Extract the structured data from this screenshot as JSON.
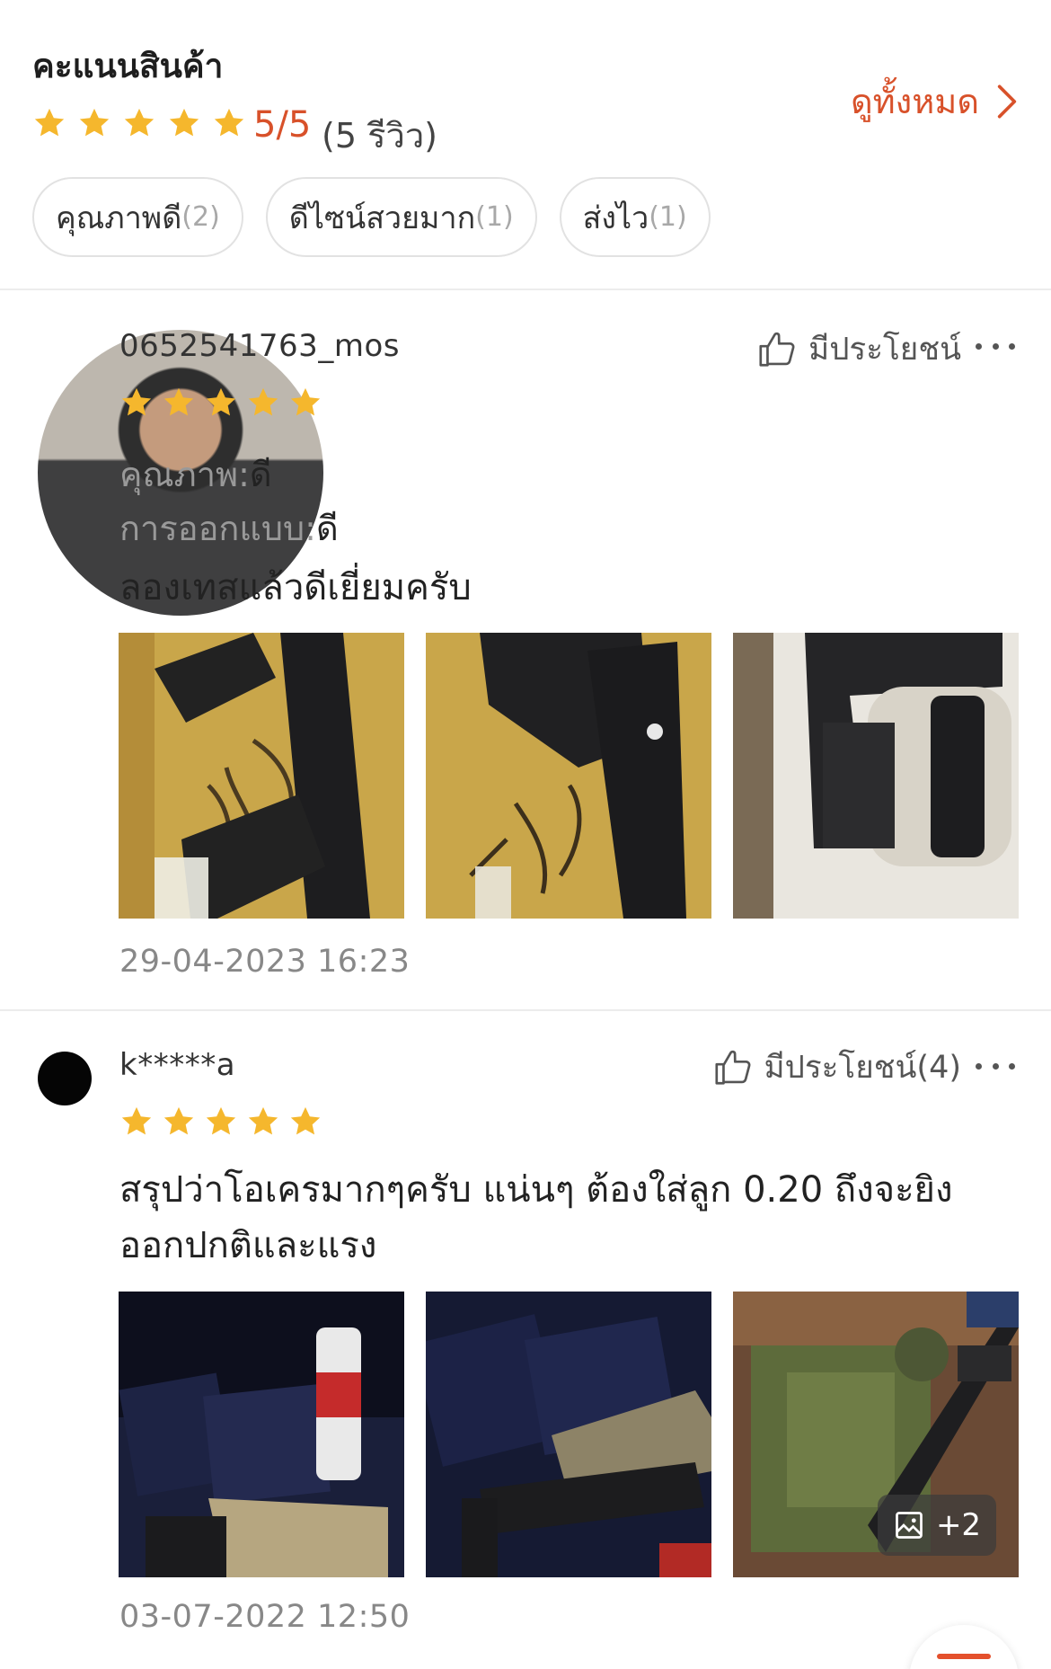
{
  "summary": {
    "title": "คะแนนสินค้า",
    "score": "5/5",
    "review_count": "(5 รีวิว)",
    "see_all": "ดูทั้งหมด",
    "tags": [
      {
        "label": "คุณภาพดี",
        "count": "(2)"
      },
      {
        "label": "ดีไซน์สวยมาก",
        "count": "(1)"
      },
      {
        "label": "ส่งไว",
        "count": "(1)"
      }
    ]
  },
  "reviews": [
    {
      "username": "0652541763_mos",
      "helpful": "มีประโยชน์",
      "rating": 5,
      "attributes": [
        {
          "label": "คุณภาพ:",
          "value": "ดี"
        },
        {
          "label": "การออกแบบ:",
          "value": "ดี"
        }
      ],
      "comment": "ลองเทสแล้วดีเยี่ยมครับ",
      "timestamp": "29-04-2023 16:23"
    },
    {
      "username": "k*****a",
      "helpful": "มีประโยชน์(4)",
      "rating": 5,
      "comment": "สรุปว่าโอเครมากๆครับ แน่นๆ ต้องใส่ลูก 0.20 ถึงจะยิงออกปกติและแรง",
      "comment_line1": "สรุปว่าโอเครมากๆครับ แน่นๆ ต้องใส่ลูก 0.20 ถึงจะยิง",
      "comment_line2": "ออกปกติและแรง",
      "more_photos": "+2",
      "timestamp": "03-07-2022 12:50"
    }
  ],
  "colors": {
    "accent": "#d8512a",
    "star": "#f5b72d"
  },
  "icons": {
    "star": "star-icon",
    "chevron": "chevron-right-icon",
    "thumbs_up": "thumbs-up-icon",
    "more": "more-dots-icon",
    "image": "image-icon",
    "scroll_top": "scroll-top-icon"
  }
}
